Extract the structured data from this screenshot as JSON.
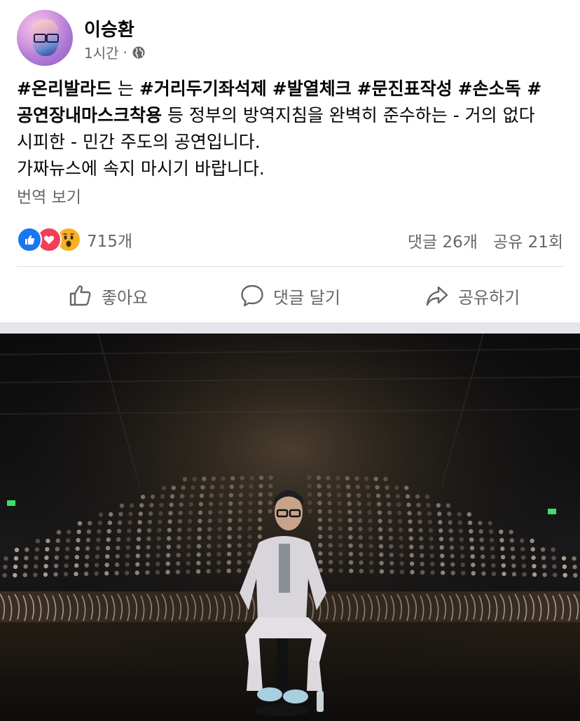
{
  "post": {
    "author": "이승환",
    "time": "1시간",
    "dot": "·",
    "text": {
      "l1": [
        {
          "t": "#온리발라드",
          "bold": true
        },
        {
          "t": " 는 ",
          "bold": false
        },
        {
          "t": "#거리두기좌석제",
          "bold": true
        },
        {
          "t": " ",
          "bold": false
        },
        {
          "t": "#발열체크",
          "bold": true
        },
        {
          "t": " ",
          "bold": false
        },
        {
          "t": "#문진표작성",
          "bold": true
        },
        {
          "t": " ",
          "bold": false
        },
        {
          "t": "#손소독",
          "bold": true
        },
        {
          "t": " #",
          "bold": true
        }
      ],
      "l2_tag": "공연장내마스크착용",
      "l2_rest": " 등 정부의 방역지침을 완벽히 준수하는 - 거의 없다",
      "l3": "시피한 - 민간 주도의 공연입니다.",
      "l4": "가짜뉴스에 속지 마시기 바랍니다."
    },
    "translate_label": "번역 보기",
    "reaction_count": "715개",
    "comments": "댓글 26개",
    "shares": "공유 21회"
  },
  "actions": {
    "like": "좋아요",
    "comment": "댓글 달기",
    "share": "공유하기"
  },
  "colors": {
    "like": "#1877f2",
    "love": "#f33e58",
    "wow": "#f7b125",
    "secondary_text": "#65676b"
  }
}
